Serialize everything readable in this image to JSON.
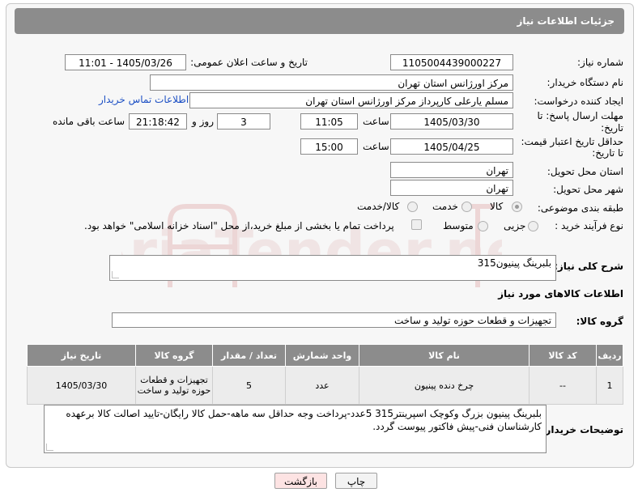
{
  "header": {
    "title": "جزئیات اطلاعات نیاز"
  },
  "fields": {
    "need_number_label": "شماره نیاز:",
    "need_number": "1105004439000227",
    "announce_label": "تاریخ و ساعت اعلان عمومی:",
    "announce_value": "1405/03/26 - 11:01",
    "buyer_org_label": "نام دستگاه خریدار:",
    "buyer_org": "مرکز اورژانس استان تهران",
    "creator_label": "ایجاد کننده درخواست:",
    "creator": "مسلم یارعلی کارپرداز مرکز اورژانس استان تهران",
    "contact_link": "اطلاعات تماس خریدار",
    "deadline_label_1": "مهلت ارسال پاسخ: تا",
    "deadline_label_2": "تاریخ:",
    "deadline_date": "1405/03/30",
    "time_label": "ساعت",
    "deadline_time": "11:05",
    "days_value": "3",
    "days_label": "روز و",
    "remaining_time": "21:18:42",
    "remaining_label": "ساعت باقی مانده",
    "validity_label_1": "حداقل تاریخ اعتبار قیمت:",
    "validity_label_2": "تا تاریخ:",
    "validity_date": "1405/04/25",
    "validity_time": "15:00",
    "province_label": "استان محل تحویل:",
    "province": "تهران",
    "city_label": "شهر محل تحویل:",
    "city": "تهران",
    "category_label": "طبقه بندی موضوعی:",
    "category_options": [
      "کالا",
      "خدمت",
      "کالا/خدمت"
    ],
    "process_label": "نوع فرآیند خرید :",
    "process_options": [
      "جزیی",
      "متوسط"
    ],
    "payment_text": "پرداخت تمام یا بخشی از مبلغ خرید،از محل \"اسناد خزانه اسلامی\" خواهد بود."
  },
  "description": {
    "label": "شرح کلی نیاز:",
    "value": "بلبرینگ پینیون315"
  },
  "goods": {
    "section_title": "اطلاعات کالاهای مورد نیاز",
    "group_label": "گروه کالا:",
    "group_value": "تجهیزات و قطعات حوزه تولید و ساخت",
    "columns": [
      "ردیف",
      "کد کالا",
      "نام کالا",
      "واحد شمارش",
      "تعداد / مقدار",
      "گروه کالا",
      "تاریخ نیاز"
    ],
    "rows": [
      {
        "row": "1",
        "code": "--",
        "name": "چرخ دنده پینیون",
        "unit": "عدد",
        "qty": "5",
        "group": "تجهیزات و قطعات حوزه تولید و ساخت",
        "date": "1405/03/30"
      }
    ]
  },
  "buyer_notes": {
    "label": "توضیحات خریدار:",
    "value": "بلبرینگ پینیون بزرگ وکوچک اسپرینتر315      5عدد-پرداخت وجه حداقل سه ماهه-حمل کالا رایگان-تایید اصالت کالا برعهده کارشناسان فنی-پیش فاکتور پیوست گردد."
  },
  "buttons": {
    "print": "چاپ",
    "back": "بازگشت"
  },
  "colors": {
    "header_bg": "#8c8c8c",
    "link": "#1c4fc4",
    "back_button_bg": "#fde3e3"
  }
}
